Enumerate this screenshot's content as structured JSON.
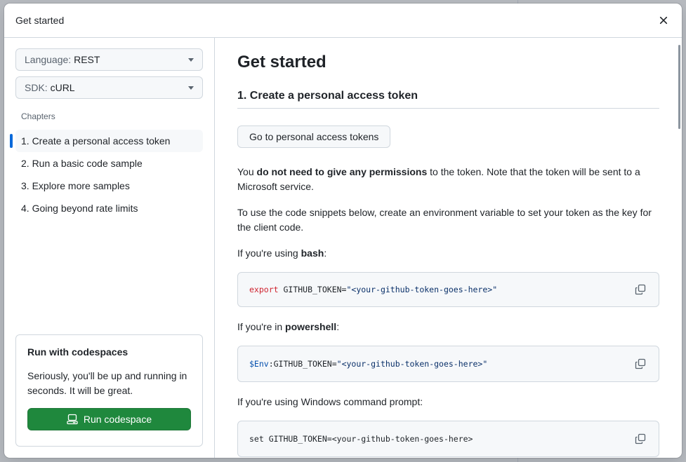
{
  "modal": {
    "title": "Get started"
  },
  "left": {
    "language": {
      "label": "Language:",
      "value": "REST"
    },
    "sdk": {
      "label": "SDK:",
      "value": "cURL"
    },
    "chapters_heading": "Chapters",
    "chapters": [
      {
        "label": "1. Create a personal access token",
        "active": true
      },
      {
        "label": "2. Run a basic code sample",
        "active": false
      },
      {
        "label": "3. Explore more samples",
        "active": false
      },
      {
        "label": "4. Going beyond rate limits",
        "active": false
      }
    ],
    "codespace": {
      "title": "Run with codespaces",
      "text": "Seriously, you'll be up and running in seconds. It will be great.",
      "button": "Run codespace"
    }
  },
  "main": {
    "title": "Get started",
    "section_title": "1. Create a personal access token",
    "pat_button": "Go to personal access tokens",
    "p1": {
      "pre": "You ",
      "bold": "do not need to give any permissions",
      "post": " to the token. Note that the token will be sent to a Microsoft service."
    },
    "p2": "To use the code snippets below, create an environment variable to set your token as the key for the client code.",
    "bash": {
      "pre": "If you're using ",
      "bold": "bash",
      "post": ":",
      "code_kw": "export",
      "code_mid": " GITHUB_TOKEN=",
      "code_str": "\"<your-github-token-goes-here>\""
    },
    "powershell": {
      "pre": "If you're in ",
      "bold": "powershell",
      "post": ":",
      "code_var": "$Env",
      "code_mid": ":GITHUB_TOKEN=",
      "code_str": "\"<your-github-token-goes-here>\""
    },
    "cmd": {
      "text": "If you're using Windows command prompt:",
      "code": "set GITHUB_TOKEN=<your-github-token-goes-here>"
    }
  },
  "colors": {
    "accent": "#0969da",
    "primary_button": "#1f883d",
    "keyword": "#cf222e",
    "string": "#0a3069"
  }
}
